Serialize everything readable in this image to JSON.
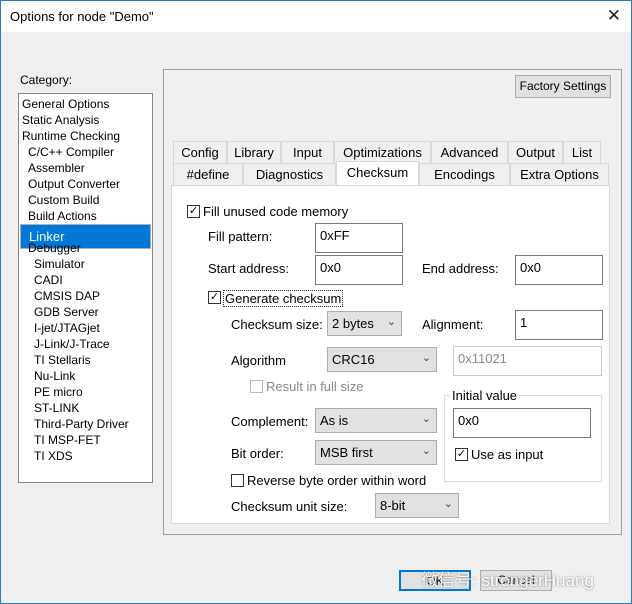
{
  "window": {
    "title": "Options for node \"Demo\"",
    "close_icon": "close-icon"
  },
  "category": {
    "label": "Category:",
    "items": [
      {
        "label": "General Options",
        "level": 0
      },
      {
        "label": "Static Analysis",
        "level": 0
      },
      {
        "label": "Runtime Checking",
        "level": 0
      },
      {
        "label": "C/C++ Compiler",
        "level": 1
      },
      {
        "label": "Assembler",
        "level": 1
      },
      {
        "label": "Output Converter",
        "level": 1
      },
      {
        "label": "Custom Build",
        "level": 1
      },
      {
        "label": "Build Actions",
        "level": 1
      },
      {
        "label": "Linker",
        "level": 1,
        "selected": true
      },
      {
        "label": "Debugger",
        "level": 1
      },
      {
        "label": "Simulator",
        "level": 2
      },
      {
        "label": "CADI",
        "level": 2
      },
      {
        "label": "CMSIS DAP",
        "level": 2
      },
      {
        "label": "GDB Server",
        "level": 2
      },
      {
        "label": "I-jet/JTAGjet",
        "level": 2
      },
      {
        "label": "J-Link/J-Trace",
        "level": 2
      },
      {
        "label": "TI Stellaris",
        "level": 2
      },
      {
        "label": "Nu-Link",
        "level": 2
      },
      {
        "label": "PE micro",
        "level": 2
      },
      {
        "label": "ST-LINK",
        "level": 2
      },
      {
        "label": "Third-Party Driver",
        "level": 2
      },
      {
        "label": "TI MSP-FET",
        "level": 2
      },
      {
        "label": "TI XDS",
        "level": 2
      }
    ]
  },
  "factory_settings": "Factory Settings",
  "tabs_row1": [
    "Config",
    "Library",
    "Input",
    "Optimizations",
    "Advanced",
    "Output",
    "List"
  ],
  "tabs_row2": [
    "#define",
    "Diagnostics",
    "Checksum",
    "Encodings",
    "Extra Options"
  ],
  "active_tab": "Checksum",
  "checksum": {
    "fill_unused": {
      "label": "Fill unused code memory",
      "checked": true
    },
    "fill_pattern": {
      "label": "Fill pattern:",
      "value": "0xFF"
    },
    "start_address": {
      "label": "Start address:",
      "value": "0x0"
    },
    "end_address": {
      "label": "End address:",
      "value": "0x0"
    },
    "generate": {
      "label": "Generate checksum",
      "checked": true
    },
    "size": {
      "label": "Checksum size:",
      "value": "2 bytes"
    },
    "alignment": {
      "label": "Alignment:",
      "value": "1"
    },
    "algorithm": {
      "label": "Algorithm",
      "value": "CRC16",
      "poly": "0x11021"
    },
    "result_full": {
      "label": "Result in full size",
      "checked": false,
      "disabled": true
    },
    "initial": {
      "label": "Initial value",
      "value": "0x0",
      "use_as_input": "Use as input",
      "use_checked": true
    },
    "complement": {
      "label": "Complement:",
      "value": "As is"
    },
    "bit_order": {
      "label": "Bit order:",
      "value": "MSB first"
    },
    "reverse": {
      "label": "Reverse byte order within word",
      "checked": false
    },
    "unit_size": {
      "label": "Checksum unit size:",
      "value": "8-bit"
    }
  },
  "buttons": {
    "ok": "OK",
    "cancel": "Cancel"
  },
  "watermark": "微信号: strongerHuang",
  "colors": {
    "selection": "#0078d7",
    "border": "#2b79c2"
  }
}
